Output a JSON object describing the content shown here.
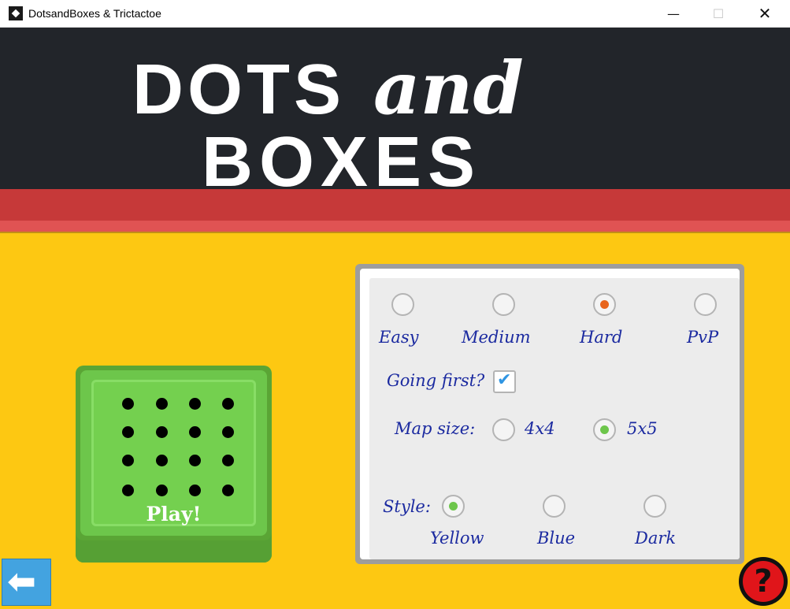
{
  "window": {
    "title": "DotsandBoxes & Trictactoe",
    "minimize_glyph": "—",
    "maximize_glyph": "☐",
    "close_glyph": "✕"
  },
  "header": {
    "title_word1": "DOTS",
    "title_word2": "and",
    "title_word3": "BOXES"
  },
  "play_button": {
    "label": "Play!",
    "dot_grid": "4x4"
  },
  "settings": {
    "difficulty": {
      "options": [
        "Easy",
        "Medium",
        "Hard",
        "PvP"
      ],
      "selected": "Hard"
    },
    "going_first": {
      "label": "Going first?",
      "checked": true
    },
    "map_size": {
      "label": "Map size:",
      "options": [
        "4x4",
        "5x5"
      ],
      "selected": "5x5"
    },
    "style": {
      "label": "Style:",
      "options": [
        "Yellow",
        "Blue",
        "Dark"
      ],
      "selected": "Yellow"
    }
  },
  "nav": {
    "back_icon": "arrow-left-icon",
    "help_icon": "question-mark-icon",
    "help_glyph": "?"
  },
  "colors": {
    "background": "#fdc812",
    "header": "#22252a",
    "accent_red": "#c63939",
    "play_green": "#6dc64b",
    "label_blue": "#1b2aa0",
    "radio_selected_orange": "#e8641b",
    "radio_selected_green": "#6dc64b"
  }
}
